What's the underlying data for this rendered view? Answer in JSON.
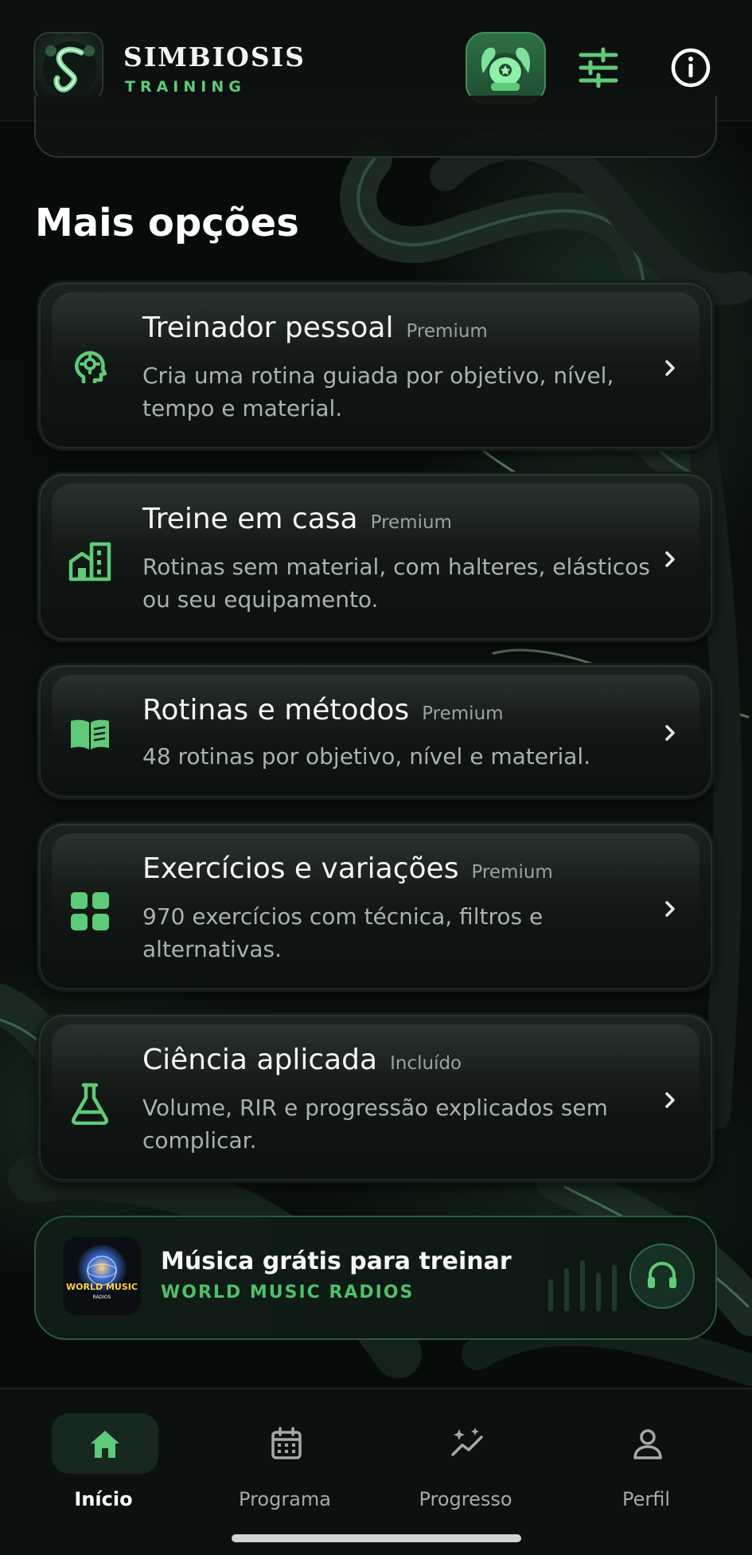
{
  "header": {
    "brand_name": "SIMBIOSIS",
    "brand_sub": "TRAINING",
    "icons": [
      "app-logo-icon",
      "bodybuilder-avatar-icon",
      "sliders-icon",
      "info-icon"
    ]
  },
  "section_title": "Mais opções",
  "options": [
    {
      "title": "Treinador pessoal",
      "tag": "Premium",
      "desc": "Cria uma rotina guiada por objetivo, nível, tempo e material.",
      "icon": "brain-gear-icon"
    },
    {
      "title": "Treine em casa",
      "tag": "Premium",
      "desc": "Rotinas sem material, com halteres, elásticos ou seu equipamento.",
      "icon": "buildings-icon"
    },
    {
      "title": "Rotinas e métodos",
      "tag": "Premium",
      "desc": "48 rotinas por objetivo, nível e material.",
      "icon": "open-book-icon"
    },
    {
      "title": "Exercícios e variações",
      "tag": "Premium",
      "desc": "970 exercícios com técnica, filtros e alternativas.",
      "icon": "grid-icon"
    },
    {
      "title": "Ciência aplicada",
      "tag": "Incluído",
      "desc": "Volume, RIR e progressão explicados sem complicar.",
      "icon": "flask-icon"
    }
  ],
  "music": {
    "title": "Música grátis para treinar",
    "subtitle": "WORLD MUSIC RADIOS",
    "logo_text": "WORLD MUSIC",
    "logo_sub": "RADIOS",
    "icon": "headphones-icon"
  },
  "nav": [
    {
      "label": "Início",
      "icon": "home-icon",
      "active": true
    },
    {
      "label": "Programa",
      "icon": "calendar-icon",
      "active": false
    },
    {
      "label": "Progresso",
      "icon": "sparkle-chart-icon",
      "active": false
    },
    {
      "label": "Perfil",
      "icon": "person-icon",
      "active": false
    }
  ],
  "colors": {
    "accent": "#5fca78",
    "background": "#050807",
    "header": "#0c100e"
  }
}
